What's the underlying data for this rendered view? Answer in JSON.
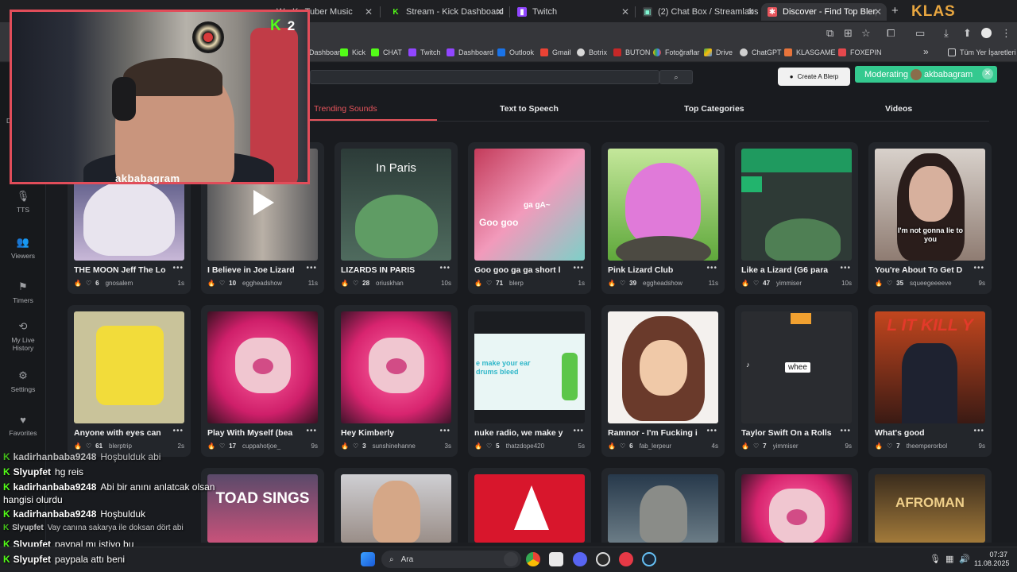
{
  "browser": {
    "tabs": [
      {
        "label": "Stream - Kick Dashboard",
        "icon": "kick-icon"
      },
      {
        "label": "Twitch",
        "icon": "twitch-icon"
      },
      {
        "label": "(2) Chat Box / Streamlabs",
        "icon": "streamlabs-icon"
      },
      {
        "label": "Discover - Find Top Blerps, Stre",
        "icon": "blerp-icon"
      }
    ],
    "partial_tab": "WorKs Tuber Music",
    "new_tab": "+",
    "profile_text": "KLAS",
    "bookmarks": [
      "Dashboard",
      "Kick",
      "CHAT",
      "Twitch",
      "Dashboard",
      "Outlook",
      "Gmail",
      "Botrix",
      "BUTON",
      "Fotoğraflar",
      "Drive",
      "ChatGPT",
      "KLASGAME",
      "FOXEPIN"
    ],
    "bookmarks_overflow": "»",
    "all_bookmarks": "Tüm Yer İşaretleri"
  },
  "leftnav": [
    {
      "label": "Da",
      "icon": "dashboard-icon"
    },
    {
      "label": "TTS",
      "icon": "microphone-icon"
    },
    {
      "label": "Viewers",
      "icon": "users-icon"
    },
    {
      "label": "Timers",
      "icon": "flag-icon"
    },
    {
      "label": "My Live History",
      "icon": "history-icon"
    },
    {
      "label": "Settings",
      "icon": "gear-icon"
    },
    {
      "label": "Favorites",
      "icon": "heart-icon"
    }
  ],
  "header": {
    "search_button": "⌕",
    "create_blerp": "Create A Blerp",
    "moderating_label": "Moderating",
    "moderating_user": "akbabagram"
  },
  "subnav": [
    "Trending Sounds",
    "Text to Speech",
    "Top Categories",
    "Videos"
  ],
  "cards_row1": [
    {
      "title": "THE MOON Jeff The Lo",
      "likes": "6",
      "user": "gnosalem",
      "dur": "1s"
    },
    {
      "title": "I Believe in Joe Lizard",
      "likes": "10",
      "user": "eggheadshow",
      "dur": "11s"
    },
    {
      "title": "LIZARDS IN PARIS",
      "likes": "28",
      "user": "oriuskhan",
      "dur": "10s"
    },
    {
      "title": "Goo goo ga ga short l",
      "likes": "71",
      "user": "blerp",
      "dur": "1s"
    },
    {
      "title": "Pink Lizard Club",
      "likes": "39",
      "user": "eggheadshow",
      "dur": "11s"
    },
    {
      "title": "Like a Lizard (G6 para",
      "likes": "47",
      "user": "yimmiser",
      "dur": "10s"
    },
    {
      "title": "You're About To Get D",
      "likes": "35",
      "user": "squeegeeeeve",
      "dur": "9s"
    }
  ],
  "cards_row2": [
    {
      "title": "Anyone with eyes can",
      "likes": "61",
      "user": "blerptrip",
      "dur": "2s"
    },
    {
      "title": "Play With Myself (bea",
      "likes": "17",
      "user": "cuppahotjoe_",
      "dur": "9s"
    },
    {
      "title": "Hey Kimberly",
      "likes": "3",
      "user": "sunshinehanne",
      "dur": "3s"
    },
    {
      "title": "nuke radio, we make y",
      "likes": "5",
      "user": "thatzdope420",
      "dur": "5s"
    },
    {
      "title": "Ramnor - I'm Fucking i",
      "likes": "6",
      "user": "fab_lerpeur",
      "dur": "4s"
    },
    {
      "title": "Taylor Swift On a Rolls",
      "likes": "7",
      "user": "yimmiser",
      "dur": "9s"
    },
    {
      "title": "What's good",
      "likes": "7",
      "user": "theemperorbol",
      "dur": "9s"
    }
  ],
  "thumb_text": {
    "paris": "In Paris",
    "goo_top": "ga gA~",
    "goo": "Goo goo",
    "lizard_top": "I'm not gonna lie to you",
    "nuke": "e make your ear drums bleed",
    "whee": "whee",
    "kill": "L IT KILL Y",
    "toad": "TOAD SINGS",
    "afro": "AFROMAN"
  },
  "webcam": {
    "name": "akbabagram",
    "viewer_count": "2"
  },
  "chat": [
    {
      "name": "kadirhanbaba9248",
      "msg": "Hoşbulduk abi"
    },
    {
      "name": "Slyupfet",
      "msg": "hg reis"
    },
    {
      "name": "kadirhanbaba9248",
      "msg": "Abi bir anını anlatcak olsan"
    },
    {
      "name": "",
      "msg": "hangisi olurdu"
    },
    {
      "name": "kadirhanbaba9248",
      "msg": "Hoşbulduk"
    },
    {
      "name": "Slyupfet",
      "msg": "Vay canına sakarya ile doksan dört abi"
    },
    {
      "name": "Slyupfet",
      "msg": "paypal mı istiyo bu"
    },
    {
      "name": "Slyupfet",
      "msg": "paypala attı beni"
    }
  ],
  "taskbar": {
    "search_label": "Ara",
    "time": "07:37",
    "date": "11.08.2025"
  }
}
